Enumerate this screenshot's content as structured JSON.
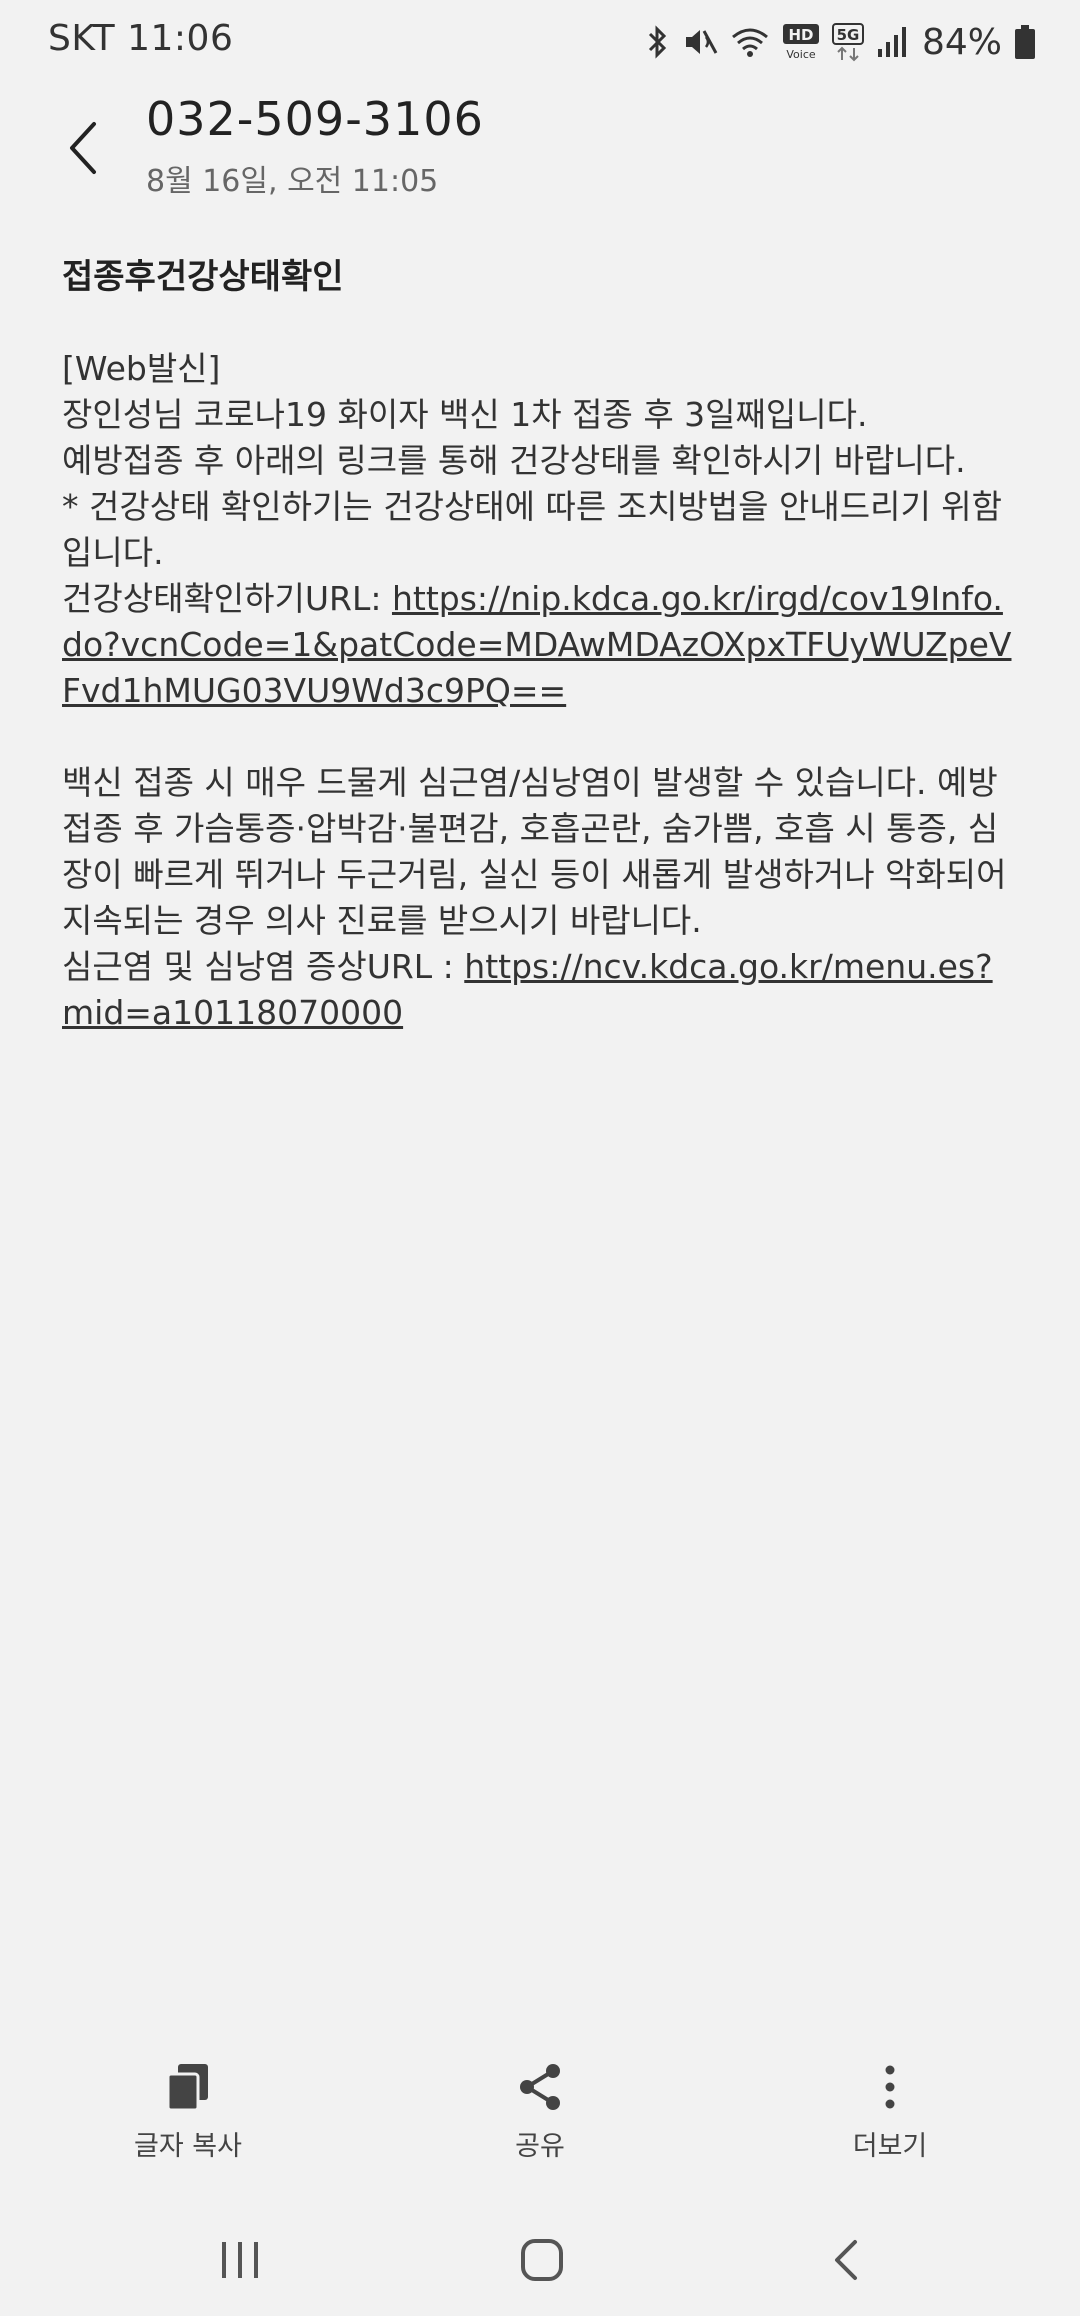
{
  "status_bar": {
    "carrier_time": "SKT 11:06",
    "battery": "84%",
    "hd_label": "HD",
    "voice_label": "Voice",
    "network_label": "5G",
    "icons": [
      "bluetooth-icon",
      "mute-icon",
      "wifi-icon",
      "hd-voice-icon",
      "5g-icon",
      "signal-icon",
      "battery-icon"
    ]
  },
  "header": {
    "title": "032-509-3106",
    "subtitle": "8월 16일, 오전 11:05"
  },
  "message": {
    "heading": "접종후건강상태확인",
    "p1": {
      "line1": "[Web발신]",
      "line2": "장인성님 코로나19 화이자 백신 1차 접종 후 3일째입니다.",
      "line3": "예방접종 후 아래의 링크를 통해 건강상태를 확인하시기 바랍니다.",
      "line4": "* 건강상태 확인하기는 건강상태에 따른 조치방법을 안내드리기 위함입니다.",
      "url_label": "건강상태확인하기URL: ",
      "url": "https://nip.kdca.go.kr/irgd/cov19Info.do?vcnCode=1&patCode=MDAwMDAzOXpxTFUyWUZpeVFvd1hMUG03VU9Wd3c9PQ=="
    },
    "p2": {
      "line1": "백신 접종 시 매우 드물게 심근염/심낭염이 발생할 수 있습니다. 예방접종 후 가슴통증·압박감·불편감, 호흡곤란, 숨가쁨, 호흡 시 통증, 심장이 빠르게 뛰거나 두근거림, 실신 등이 새롭게 발생하거나 악화되어 지속되는 경우 의사 진료를 받으시기 바랍니다.",
      "url_label": "심근염 및 심낭염 증상URL : ",
      "url": "https://ncv.kdca.go.kr/menu.es?mid=a10118070000"
    }
  },
  "actions": {
    "copy_label": "글자 복사",
    "share_label": "공유",
    "more_label": "더보기"
  },
  "colors": {
    "background": "#f2f2f2",
    "text": "#333333",
    "icon": "#444444"
  }
}
